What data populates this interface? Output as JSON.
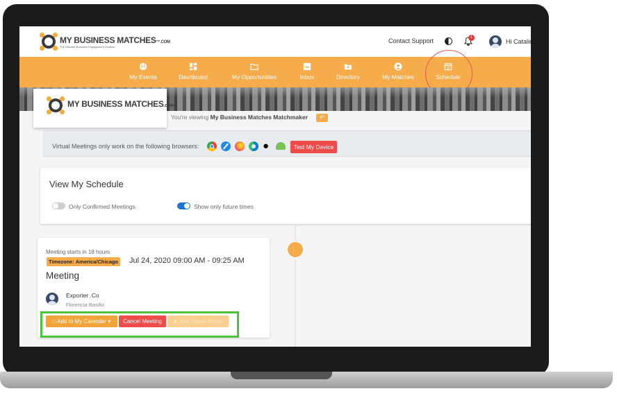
{
  "header": {
    "logo_text": "MY BUSINESS MATCHES",
    "logo_suffix": "™.COM",
    "logo_tagline": "The Ultimate Business Engagement Solution",
    "contact_support": "Contact Support",
    "notification_count": "1",
    "greeting": "Hi Catalin"
  },
  "nav": {
    "items": [
      {
        "label": "My Events",
        "icon": "globe-icon"
      },
      {
        "label": "Dashboard",
        "icon": "dashboard-icon"
      },
      {
        "label": "My Opportunities",
        "icon": "folder-icon"
      },
      {
        "label": "Inbox",
        "icon": "inbox-icon"
      },
      {
        "label": "Directory",
        "icon": "directory-icon"
      },
      {
        "label": "My Matches",
        "icon": "user-circle-icon"
      },
      {
        "label": "Schedule",
        "icon": "calendar-icon"
      }
    ]
  },
  "banner": {
    "logo_text": "MY BUSINESS MATCHES",
    "logo_suffix": ".com",
    "viewing_prefix": "You're viewing",
    "viewing_name": "My Business Matches Matchmaker"
  },
  "browsers": {
    "text": "Virtual Meetings only work on the following browsers:",
    "icons": [
      "chrome-icon",
      "safari-icon",
      "firefox-icon",
      "edge-icon",
      "apple-icon",
      "android-icon"
    ],
    "test_button": "Test My Device"
  },
  "schedule": {
    "title": "View My Schedule",
    "toggle_confirmed_label": "Only Confirmed Meetings",
    "toggle_confirmed_on": false,
    "toggle_future_label": "Show only future times",
    "toggle_future_on": true
  },
  "meeting": {
    "starts_in": "Meeting starts in 18 hours",
    "timezone": "Timezone: America/Chicago",
    "time": "Jul 24, 2020 09:00 AM - 09:25 AM",
    "title": "Meeting",
    "company": "Exporter .Co",
    "person": "Florencia Basilio",
    "add_calendar": "Add to My Calendar",
    "cancel": "Cancel Meeting",
    "join": "Join Virtual Room"
  },
  "colors": {
    "accent": "#f6ac4a",
    "danger": "#ee4b4b",
    "highlight_green": "#4cc33a",
    "annotation_red": "#e25555"
  }
}
